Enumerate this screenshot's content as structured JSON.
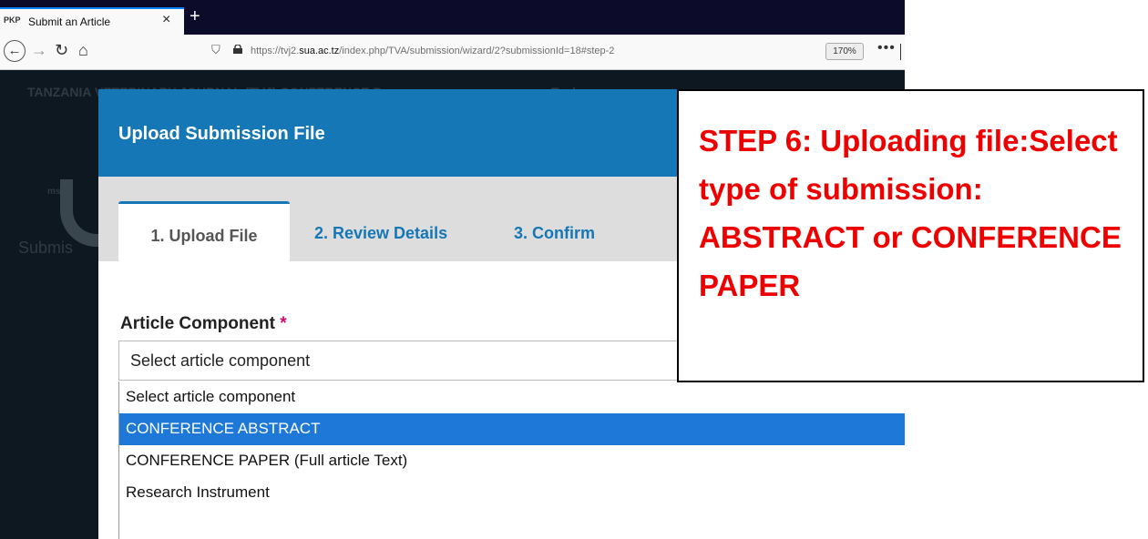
{
  "browser": {
    "tab_favicon": "PKP",
    "tab_title": "Submit an Article",
    "tab_close": "×",
    "new_tab": "+",
    "url_prefix": "https://tvj2.",
    "url_domain": "sua.ac.tz",
    "url_path": "/index.php/TVA/submission/wizard/2?submissionId=18#step-2",
    "zoom": "170%",
    "more": "•••"
  },
  "background_page": {
    "header_text": "TANZANIA VETERINARY JOURNAL (TVJ) CONFERENCE P",
    "tasks_text": "Tasks",
    "side_text": "Submis",
    "small_text": "ms"
  },
  "modal": {
    "title": "Upload Submission File",
    "tabs": [
      {
        "label": "1. Upload File"
      },
      {
        "label": "2. Review Details"
      },
      {
        "label": "3. Confirm"
      }
    ],
    "field_label": "Article Component",
    "required_mark": "*",
    "select_value": "Select article component",
    "options": [
      {
        "label": "Select article component"
      },
      {
        "label": "CONFERENCE ABSTRACT"
      },
      {
        "label": "CONFERENCE PAPER (Full article Text)"
      },
      {
        "label": "Research Instrument"
      }
    ]
  },
  "callout": {
    "text": "STEP 6: Uploading file:Select type of submission: ABSTRACT or CONFERENCE PAPER"
  },
  "colors": {
    "accent": "#1577b5",
    "selected_option": "#1e78d7",
    "annotation": "#ee0000"
  },
  "icons": [
    "back-icon",
    "forward-icon",
    "reload-icon",
    "home-icon",
    "shield-icon",
    "lock-icon"
  ]
}
